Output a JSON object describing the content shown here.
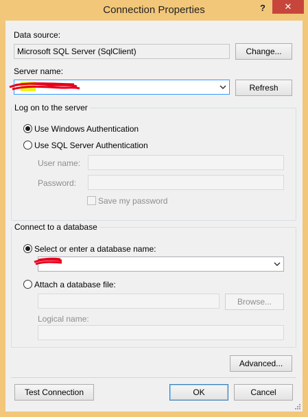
{
  "window": {
    "title": "Connection Properties",
    "help_glyph": "?",
    "close_glyph": "✕"
  },
  "data_source": {
    "label": "Data source:",
    "value": "Microsoft SQL Server (SqlClient)",
    "change_label": "Change..."
  },
  "server": {
    "label": "Server name:",
    "value": "",
    "refresh_label": "Refresh"
  },
  "logon": {
    "group_title": "Log on to the server",
    "windows_auth_label": "Use Windows Authentication",
    "windows_auth_checked": true,
    "sql_auth_label": "Use SQL Server Authentication",
    "sql_auth_checked": false,
    "user_name_label": "User name:",
    "password_label": "Password:",
    "save_password_label": "Save my password"
  },
  "database": {
    "group_title": "Connect to a database",
    "select_label": "Select or enter a database name:",
    "select_checked": true,
    "database_value": "",
    "attach_label": "Attach a database file:",
    "attach_checked": false,
    "browse_label": "Browse...",
    "logical_name_label": "Logical name:"
  },
  "footer": {
    "advanced_label": "Advanced...",
    "test_label": "Test Connection",
    "ok_label": "OK",
    "cancel_label": "Cancel"
  },
  "colors": {
    "title_bar": "#f2c77a",
    "close_button": "#c7463c",
    "dialog_bg": "#f0f0f0",
    "focus_border": "#3399ff",
    "redaction": "#e8001c"
  }
}
